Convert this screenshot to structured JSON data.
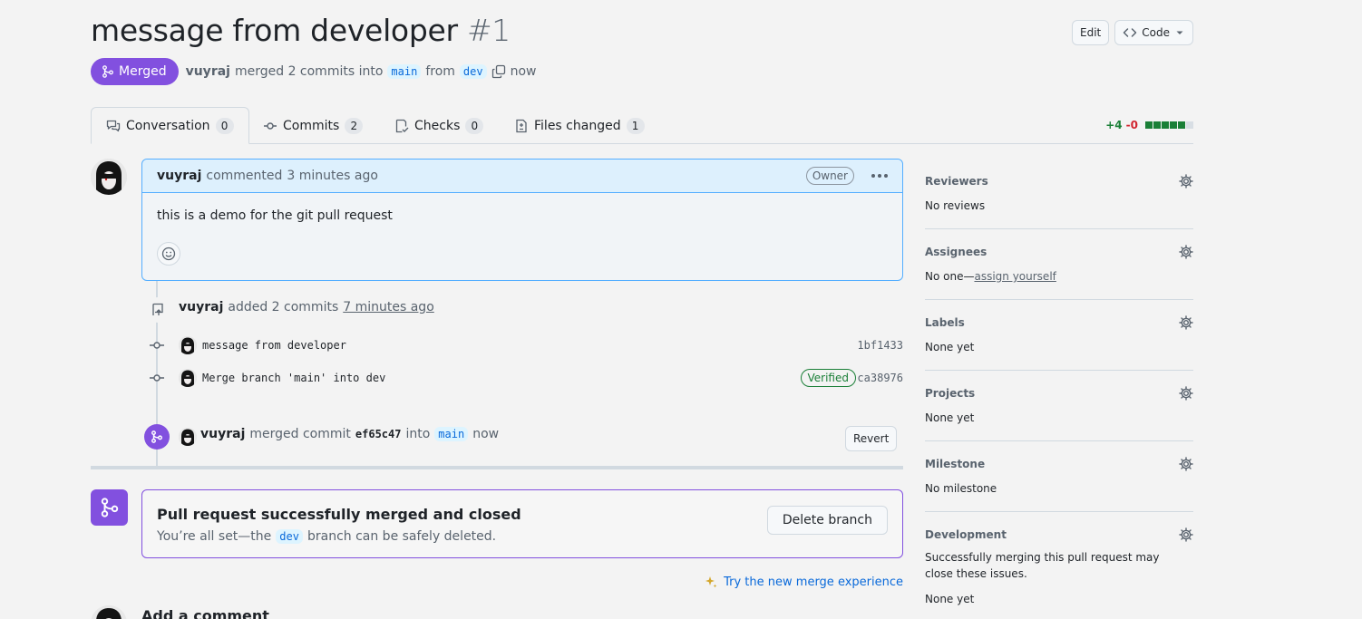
{
  "pr": {
    "title": "message from developer",
    "number": "#1",
    "state": "Merged",
    "author": "vuyraj",
    "merged_text": "merged 2 commits into",
    "base_branch": "main",
    "from_text": "from",
    "head_branch": "dev",
    "time": "now"
  },
  "header": {
    "edit_label": "Edit",
    "code_label": "Code"
  },
  "tabs": [
    {
      "label": "Conversation",
      "count": "0"
    },
    {
      "label": "Commits",
      "count": "2"
    },
    {
      "label": "Checks",
      "count": "0"
    },
    {
      "label": "Files changed",
      "count": "1"
    }
  ],
  "diffstat": {
    "additions": "+4",
    "deletions": "-0",
    "blocks_added": 5,
    "blocks_total": 5
  },
  "comment": {
    "author": "vuyraj",
    "action": "commented",
    "time": "3 minutes ago",
    "role": "Owner",
    "body": "this is a demo for the git pull request"
  },
  "commits_event": {
    "author": "vuyraj",
    "text": "added 2 commits",
    "time": "7 minutes ago"
  },
  "commits": [
    {
      "message": "message from developer",
      "sha": "1bf1433",
      "verified": ""
    },
    {
      "message": "Merge branch 'main' into dev",
      "sha": "ca38976",
      "verified": "Verified"
    }
  ],
  "merge_event": {
    "author": "vuyraj",
    "text": "merged commit",
    "sha": "ef65c47",
    "into": "into",
    "branch": "main",
    "time": "now",
    "revert_label": "Revert"
  },
  "merged_box": {
    "title": "Pull request successfully merged and closed",
    "text_before": "You’re all set—the",
    "branch": "dev",
    "text_after": "branch can be safely deleted.",
    "delete_label": "Delete branch"
  },
  "try_link": "Try the new merge experience",
  "add_comment": "Add a comment",
  "sidebar": {
    "reviewers": {
      "title": "Reviewers",
      "value": "No reviews"
    },
    "assignees": {
      "title": "Assignees",
      "value": "No one—",
      "link": "assign yourself"
    },
    "labels": {
      "title": "Labels",
      "value": "None yet"
    },
    "projects": {
      "title": "Projects",
      "value": "None yet"
    },
    "milestone": {
      "title": "Milestone",
      "value": "No milestone"
    },
    "development": {
      "title": "Development",
      "note": "Successfully merging this pull request may close these issues.",
      "value": "None yet"
    }
  },
  "colors": {
    "merged": "#8250df",
    "accent": "#0969da",
    "success": "#1a7f37",
    "danger": "#d1242f"
  }
}
